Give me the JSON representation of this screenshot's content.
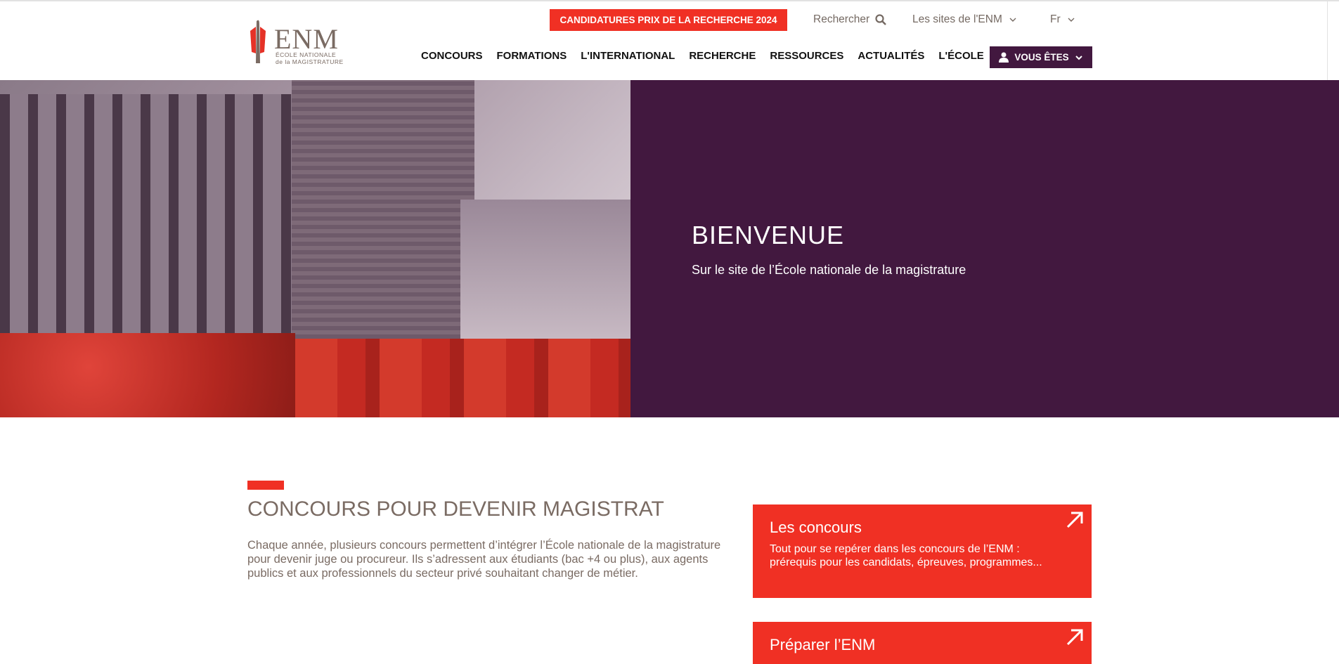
{
  "logo": {
    "title": "ENM",
    "line1": "ÉCOLE NATIONALE",
    "line2": "de la MAGISTRATURE"
  },
  "header": {
    "promo": "CANDIDATURES PRIX DE LA RECHERCHE 2024",
    "search": "Rechercher",
    "sites": "Les sites de l'ENM",
    "lang": "Fr",
    "nav": [
      "CONCOURS",
      "FORMATIONS",
      "L'INTERNATIONAL",
      "RECHERCHE",
      "RESSOURCES",
      "ACTUALITÉS",
      "L'ÉCOLE"
    ],
    "vous_etes": "VOUS ÊTES"
  },
  "hero": {
    "title": "BIENVENUE",
    "subtitle": "Sur le site de l’École nationale de la magistrature"
  },
  "section": {
    "title": "CONCOURS POUR DEVENIR MAGISTRAT",
    "text": "Chaque année, plusieurs concours permettent d’intégrer l’École nationale de la magistrature pour devenir juge ou procureur. Ils s’adressent aux étudiants (bac +4 ou plus), aux agents publics et aux professionnels du secteur privé souhaitant changer de métier."
  },
  "cards": [
    {
      "title": "Les concours",
      "text": "Tout pour se repérer dans les concours de l’ENM : prérequis pour les candidats, épreuves, programmes..."
    },
    {
      "title": "Préparer l’ENM"
    }
  ],
  "colors": {
    "accent": "#f03024",
    "purple": "#42183f",
    "text": "#7a6b63"
  }
}
